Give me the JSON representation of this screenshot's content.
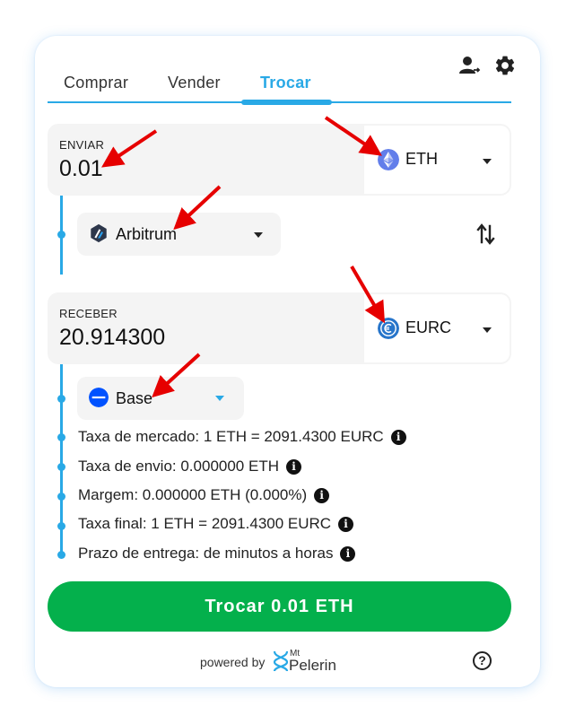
{
  "tabs": [
    {
      "label": "Comprar"
    },
    {
      "label": "Vender"
    },
    {
      "label": "Trocar"
    }
  ],
  "send": {
    "label": "ENVIAR",
    "amount": "0.01",
    "currency": "ETH",
    "network": "Arbitrum"
  },
  "receive": {
    "label": "RECEBER",
    "amount": "20.914300",
    "currency": "EURC",
    "network": "Base"
  },
  "info": [
    {
      "text": "Taxa de mercado: 1 ETH = 2091.4300 EURC"
    },
    {
      "text": "Taxa de envio: 0.000000 ETH"
    },
    {
      "text": "Margem: 0.000000 ETH (0.000%)"
    },
    {
      "text": "Taxa final: 1 ETH = 2091.4300 EURC"
    },
    {
      "text": "Prazo de entrega: de minutos a horas"
    }
  ],
  "action": {
    "label": "Trocar 0.01 ETH"
  },
  "footer": {
    "powered_by": "powered by",
    "brand_mt": "Mt",
    "brand_name": "Pelerin",
    "help_glyph": "?"
  },
  "info_glyph": "i",
  "icons": {
    "profile": "user-switch-icon",
    "settings": "gear-icon",
    "swap": "swap-arrows-icon",
    "help": "help-icon",
    "info": "info-icon"
  },
  "colors": {
    "accent": "#29a9e6",
    "action": "#04b04c",
    "annotation_arrow": "#e60000",
    "eth": "#627eea",
    "eurc": "#2775ca",
    "base": "#0052ff"
  }
}
